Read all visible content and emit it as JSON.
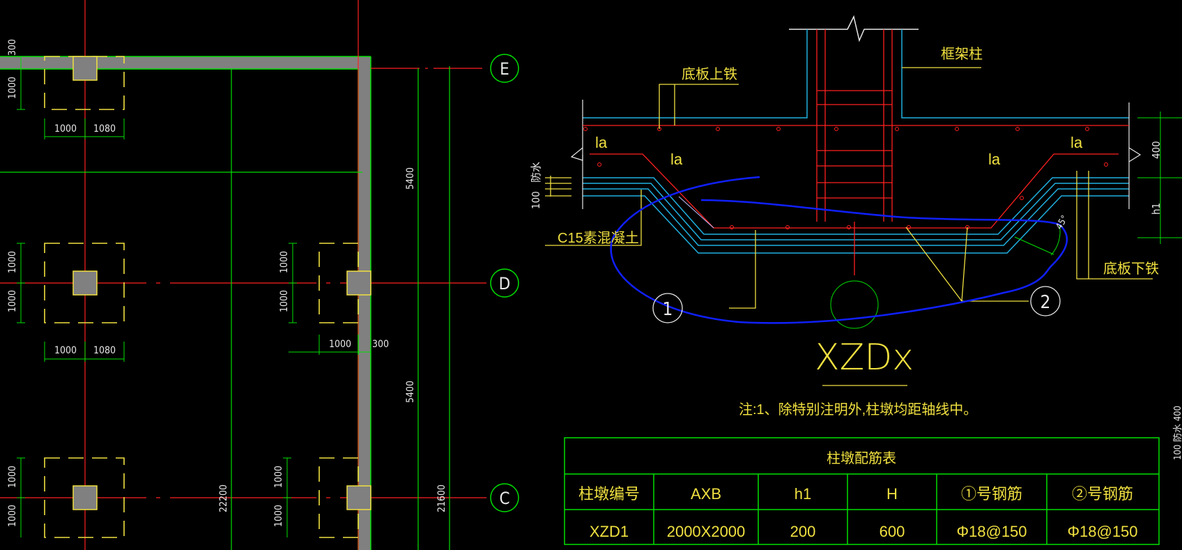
{
  "axes": {
    "E": "E",
    "D": "D",
    "C": "C"
  },
  "plan": {
    "dim_300": "300",
    "dim_1000": "1000",
    "dim_1080": "1080",
    "dim_5400": "5400",
    "dim_22200": "22200",
    "dim_21600": "21600"
  },
  "section": {
    "label_top_rebar": "底板上铁",
    "label_frame_column": "框架柱",
    "label_bottom_rebar": "底板下铁",
    "label_la": "la",
    "label_concrete": "C15素混凝土",
    "label_waterproof": "防水",
    "label_100": "100",
    "label_400": "400",
    "label_h1": "h1",
    "label_45": "45°",
    "marker_1": "1",
    "marker_2": "2",
    "title": "XZDx",
    "note": "注:1、除特别注明外,柱墩均距轴线中。",
    "right_edge_text": "100 防水 400"
  },
  "table": {
    "title": "柱墩配筋表",
    "headers": [
      "柱墩编号",
      "AXB",
      "h1",
      "H",
      "①号钢筋",
      "②号钢筋"
    ],
    "rows": [
      [
        "XZD1",
        "2000X2000",
        "200",
        "600",
        "Φ18@150",
        "Φ18@150"
      ]
    ]
  },
  "colors": {
    "red": "#ff2020",
    "green": "#00e000",
    "yellow": "#f0e040",
    "cyan": "#20b0e0",
    "blue": "#1020ff",
    "gray": "#808080",
    "white": "#e8e8e8"
  }
}
